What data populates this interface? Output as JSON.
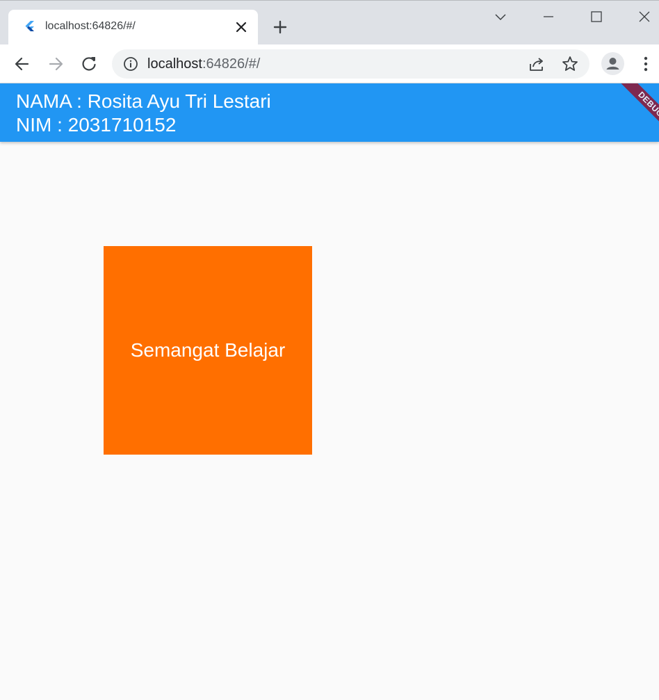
{
  "browser": {
    "tab": {
      "title": "localhost:64826/#/",
      "favicon": "flutter-logo-icon"
    },
    "address_bar": {
      "host": "localhost",
      "rest": ":64826/#/"
    },
    "colors": {
      "tabstrip": "#dee1e6",
      "toolbar": "#ffffff",
      "omnibox": "#f1f3f4"
    }
  },
  "app": {
    "appbar": {
      "line1": "NAMA : Rosita Ayu Tri Lestari",
      "line2": "NIM : 2031710152",
      "color": "#2196f3"
    },
    "debug_banner": "DEBUG",
    "box": {
      "text": "Semangat Belajar",
      "color": "#ff6f00"
    },
    "background": "#fafafa"
  }
}
